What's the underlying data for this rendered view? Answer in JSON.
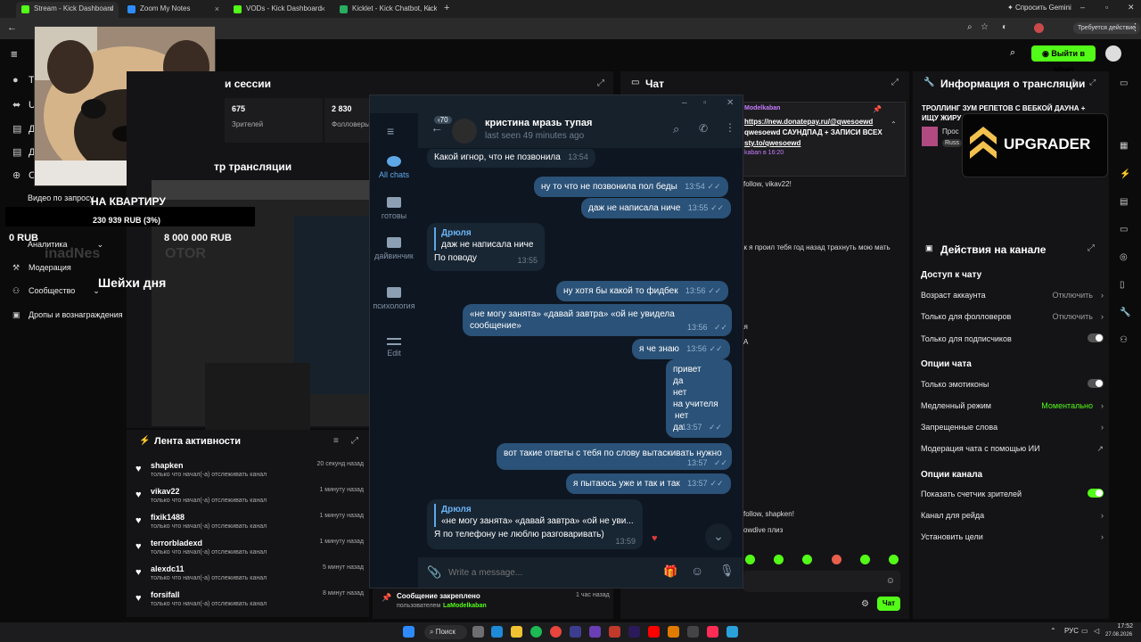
{
  "browser": {
    "tabs": [
      {
        "label": "Stream - Kick Dashboard",
        "color": "#53fc18"
      },
      {
        "label": "Zoom My Notes",
        "color": "#2d8cff"
      },
      {
        "label": "VODs - Kick Dashboard",
        "color": "#53fc18"
      },
      {
        "label": "Kicklet - Kick Chatbot, Kick Wi",
        "color": "#27ae60"
      }
    ],
    "gemini": "Спросить Gemini",
    "update_badge": "Требуется действие"
  },
  "kick": {
    "go_live": "Выйти в эфир",
    "menu": [
      {
        "label": "Тр",
        "icon": "●"
      },
      {
        "label": "UI",
        "icon": "⬌"
      },
      {
        "label": "Д",
        "icon": "▤"
      },
      {
        "label": "Д",
        "icon": "▤"
      },
      {
        "label": "С",
        "icon": "⊕"
      },
      {
        "label": "Видео по запросу",
        "icon": ""
      },
      {
        "label": "Аналитика",
        "icon": "▮"
      },
      {
        "label": "Модерация",
        "icon": "⚒"
      },
      {
        "label": "Сообщество",
        "icon": "⚇"
      },
      {
        "label": "Дропы и вознаграждения",
        "icon": "▣"
      }
    ],
    "session": {
      "title": "и сессии",
      "viewers": "675",
      "viewers_label": "Зрителей",
      "followers": "2 830",
      "followers_label": "Фолловеры"
    },
    "preview_title": "тр трансляции",
    "overlay": {
      "goal": "НА КВАРТИРУ",
      "amount": "230 939 RUB (3%)",
      "left": "0 RUB",
      "target": "8 000 000 RUB",
      "ticker": "inadNes",
      "ticker2": "OTOR",
      "shei": "Шейхи дня"
    },
    "activity": {
      "title": "Лента активности",
      "items": [
        {
          "name": "shapken",
          "sub": "только что начал(-а) отслеживать канал",
          "time": "20 секунд назад"
        },
        {
          "name": "vikav22",
          "sub": "только что начал(-а) отслеживать канал",
          "time": "1 минуту назад"
        },
        {
          "name": "fixik1488",
          "sub": "только что начал(-а) отслеживать канал",
          "time": "1 минуту назад"
        },
        {
          "name": "terrorbladexd",
          "sub": "только что начал(-а) отслеживать канал",
          "time": "1 минуту назад"
        },
        {
          "name": "alexdc11",
          "sub": "только что начал(-а) отслеживать канал",
          "time": "5 минут назад"
        },
        {
          "name": "forsifall",
          "sub": "только что начал(-а) отслеживать канал",
          "time": "8 минут назад"
        }
      ]
    },
    "pinned": {
      "title": "Сообщение закреплено",
      "by": "пользователем",
      "user": "LaModelkaban",
      "time": "1 час назад"
    },
    "chat": {
      "title": "Чат",
      "pinned_user": "Modelkaban",
      "pinned_lines": [
        "https://new.donatepay.ru/@qwesoewd",
        "qwesoewd САУНДПАД + ЗАПИСИ ВСЕХ",
        "sty.to/qwesoewd"
      ],
      "pinned_meta": "kaban в 16:20",
      "lines": [
        "follow, vikav22!",
        "ак я проил тебя год назад трахнуть мою мать",
        "ая",
        "А",
        "follow, shapken!",
        "owdive плиз"
      ],
      "send": "Чат"
    },
    "stream_info": {
      "title": "Информация о трансляции",
      "headline": "ТРОЛЛИНГ ЗУМ РЕПЕТОВ С ВЕБКОЙ ДАУНА + ИЩУ ЖИРУ",
      "cat": "Прос",
      "lang": "Russ"
    },
    "upgrader": "UPGRADER",
    "channel_actions": {
      "title": "Действия на канале",
      "chat_access": "Доступ к чату",
      "rows1": [
        {
          "label": "Возраст аккаунта",
          "value": "Отключить"
        },
        {
          "label": "Только для фолловеров",
          "value": "Отключить"
        }
      ],
      "subs_only": "Только для подписчиков",
      "chat_opts": "Опции чата",
      "emotes_only": "Только эмотиконы",
      "slow_mode": "Медленный режим",
      "slow_value": "Моментально",
      "banned_words": "Запрещенные слова",
      "ai_mod": "Модерация чата с помощью ИИ",
      "channel_opts": "Опции канала",
      "show_viewers": "Показать счетчик зрителей",
      "raid": "Канал для рейда",
      "goals": "Установить цели"
    }
  },
  "telegram": {
    "unread": "70",
    "contact": "кристина мразь тупая",
    "last_seen": "last seen 49 minutes ago",
    "folders": [
      "All chats",
      "готовы",
      "дайвинчик",
      "психология",
      "Edit"
    ],
    "messages": [
      {
        "dir": "in",
        "text": "Какой игнор, что не позвонила",
        "time": "13:54"
      },
      {
        "dir": "out",
        "text": "ну то что не позвонила пол беды",
        "time": "13:54"
      },
      {
        "dir": "out",
        "text": "даж не написала ниче",
        "time": "13:55"
      },
      {
        "dir": "in",
        "quote_name": "Дрюля",
        "quote": "даж не написала ниче",
        "text": "По поводу",
        "time": "13:55"
      },
      {
        "dir": "out",
        "text": "ну хотя бы какой то фидбек",
        "time": "13:56"
      },
      {
        "dir": "out",
        "text": "«не могу занята» «давай завтра» «ой не увидела сообщение»",
        "time": "13:56"
      },
      {
        "dir": "out",
        "text": "я че знаю",
        "time": "13:56"
      },
      {
        "dir": "out",
        "lines": [
          "привет",
          "да",
          "нет",
          "на учителя",
          "нет",
          "да"
        ],
        "time": "13:57"
      },
      {
        "dir": "out",
        "text": "вот такие ответы с тебя по слову вытаскивать нужно",
        "time": "13:57"
      },
      {
        "dir": "out",
        "text": "я пытаюсь уже и так и так",
        "time": "13:57"
      },
      {
        "dir": "in",
        "quote_name": "Дрюля",
        "quote": "«не могу занята» «давай завтра» «ой не уви...",
        "text": "Я по телефону не люблю разговаривать)",
        "time": "13:59"
      }
    ],
    "input_placeholder": "Write a message..."
  },
  "taskbar": {
    "search": "Поиск",
    "lang": "РУС",
    "time": "17:52",
    "date": "27.08.2026"
  }
}
